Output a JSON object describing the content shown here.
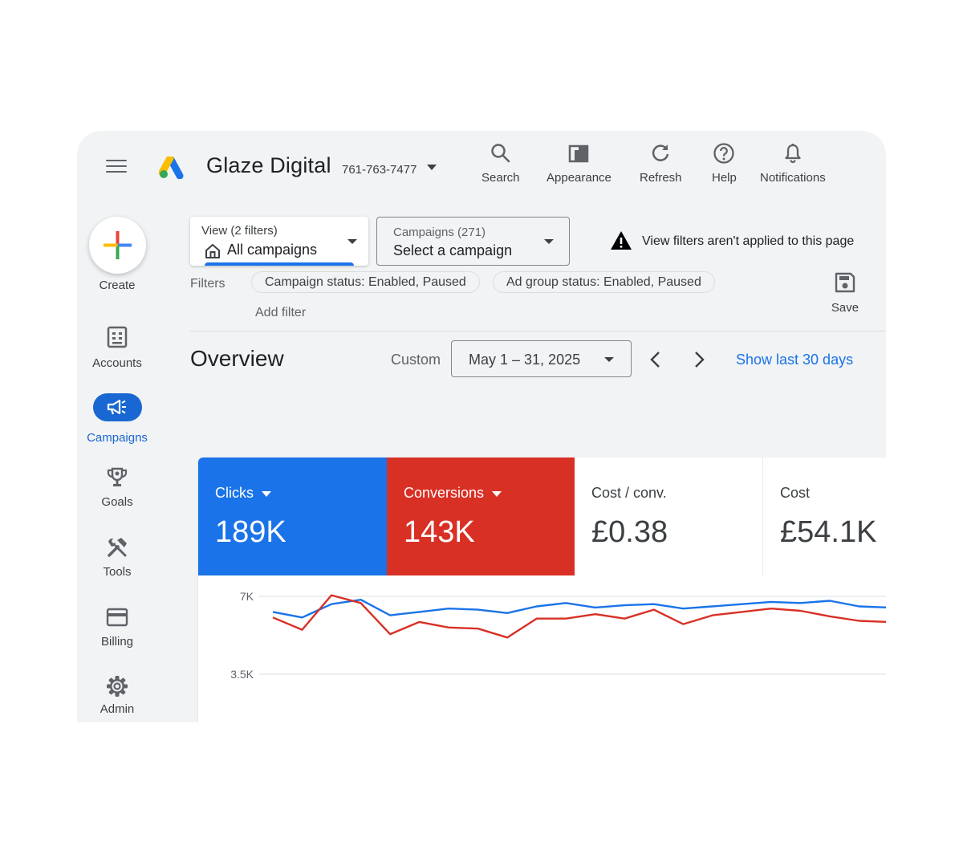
{
  "header": {
    "account_name": "Glaze Digital",
    "account_id": "761-763-7477",
    "actions": {
      "search": "Search",
      "appearance": "Appearance",
      "refresh": "Refresh",
      "help": "Help",
      "notifications": "Notifications"
    }
  },
  "sidebar": {
    "create": "Create",
    "items": [
      {
        "label": "Accounts",
        "icon": "accounts-icon"
      },
      {
        "label": "Campaigns",
        "icon": "campaigns-icon",
        "active": true
      },
      {
        "label": "Goals",
        "icon": "trophy-icon"
      },
      {
        "label": "Tools",
        "icon": "tools-icon"
      },
      {
        "label": "Billing",
        "icon": "credit-card-icon"
      },
      {
        "label": "Admin",
        "icon": "gear-icon"
      }
    ]
  },
  "view_selector": {
    "caption": "View (2 filters)",
    "value": "All campaigns"
  },
  "campaign_selector": {
    "caption": "Campaigns (271)",
    "value": "Select a campaign"
  },
  "warning": "View filters aren't applied to this page",
  "filters": {
    "label": "Filters",
    "chips": [
      "Campaign status: Enabled, Paused",
      "Ad group status: Enabled, Paused"
    ],
    "add": "Add filter",
    "save": "Save"
  },
  "overview": {
    "title": "Overview",
    "range_type": "Custom",
    "date_range": "May 1 – 31, 2025",
    "show_last": "Show last 30 days"
  },
  "metrics": [
    {
      "label": "Clicks",
      "value": "189K",
      "color": "#1a73e8",
      "selected": true
    },
    {
      "label": "Conversions",
      "value": "143K",
      "color": "#d93025",
      "selected": true
    },
    {
      "label": "Cost / conv.",
      "value": "£0.38",
      "selected": false
    },
    {
      "label": "Cost",
      "value": "£54.1K",
      "selected": false
    }
  ],
  "chart_data": {
    "type": "line",
    "y_tick_labels": [
      "7K",
      "3.5K"
    ],
    "y_ticks": [
      7000,
      3500
    ],
    "series": [
      {
        "color": "#1a73e8",
        "values": [
          6300,
          6050,
          6650,
          6850,
          6150,
          6300,
          6450,
          6400,
          6250,
          6550,
          6700,
          6500,
          6600,
          6650,
          6450,
          6550,
          6650,
          6750,
          6700,
          6800,
          6550,
          6500
        ]
      },
      {
        "color": "#d93025",
        "values": [
          6050,
          5500,
          7050,
          6700,
          5300,
          5850,
          5600,
          5550,
          5150,
          6000,
          6000,
          6200,
          6000,
          6400,
          5750,
          6150,
          6300,
          6450,
          6350,
          6100,
          5900,
          5850
        ]
      }
    ]
  }
}
